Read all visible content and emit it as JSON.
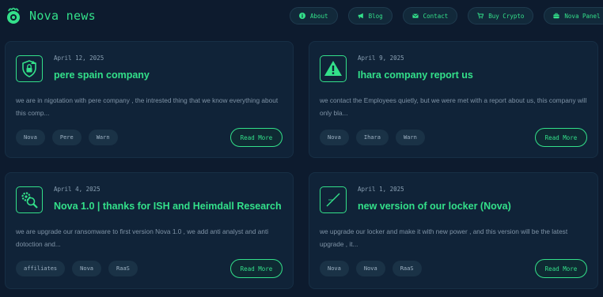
{
  "brand": {
    "title": "Nova news",
    "logo_icon": "nova-logo-icon"
  },
  "nav": [
    {
      "label": "About",
      "icon": "info-icon"
    },
    {
      "label": "Blog",
      "icon": "megaphone-icon"
    },
    {
      "label": "Contact",
      "icon": "envelope-icon"
    },
    {
      "label": "Buy Crypto",
      "icon": "cart-icon"
    },
    {
      "label": "Nova Panel",
      "icon": "briefcase-icon"
    }
  ],
  "colors": {
    "accent": "#33e08a",
    "background": "#0d1b2e",
    "card": "#102338",
    "tag": "#1a3246"
  },
  "posts": [
    {
      "date": "April 12, 2025",
      "title": "pere spain company",
      "excerpt": "we are in nigotation with pere company , the intrested thing that we know everything about this comp...",
      "tags": [
        "Nova",
        "Pere",
        "Warn"
      ],
      "read_more": "Read More",
      "icon": "shield-lock-icon"
    },
    {
      "date": "April 9, 2025",
      "title": "Ihara company report us",
      "excerpt": "we contact the Employees quietly, but we were met with a report about us, this company will only bla...",
      "tags": [
        "Nova",
        "Ihara",
        "Warn"
      ],
      "read_more": "Read More",
      "icon": "warning-icon"
    },
    {
      "date": "April 4, 2025",
      "title": "Nova 1.0 | thanks for ISH and Heimdall Research",
      "excerpt": "we are upgrade our ransomware to first version Nova 1.0 , we add anti analyst and anti dotoction and...",
      "tags": [
        "affiliates",
        "Nova",
        "RaaS"
      ],
      "read_more": "Read More",
      "icon": "gear-search-icon"
    },
    {
      "date": "April 1, 2025",
      "title": "new version of our locker (Nova)",
      "excerpt": "we upgrade our locker and make it with new power , and this version will be the latest upgrade , it...",
      "tags": [
        "Nova",
        "Nova",
        "RaaS"
      ],
      "read_more": "Read More",
      "icon": "broken-image-icon"
    }
  ]
}
